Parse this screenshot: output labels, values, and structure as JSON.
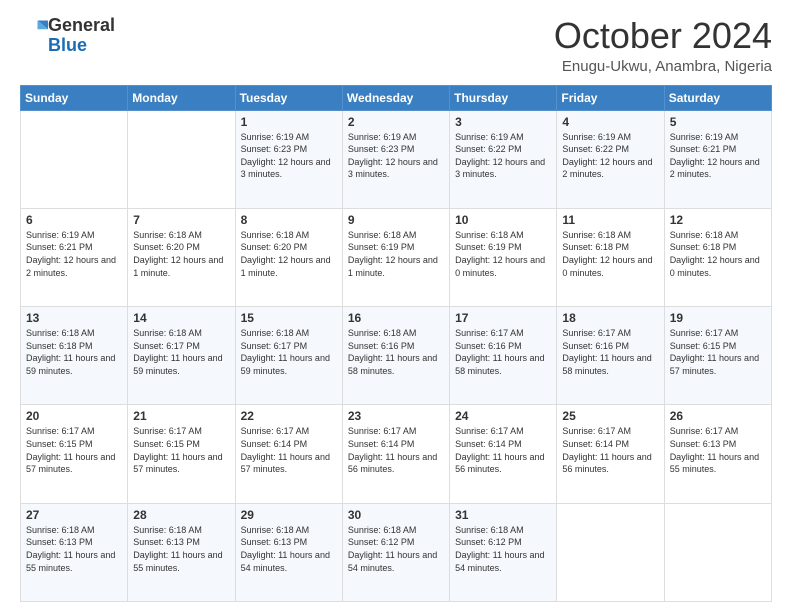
{
  "logo": {
    "general": "General",
    "blue": "Blue"
  },
  "header": {
    "month": "October 2024",
    "location": "Enugu-Ukwu, Anambra, Nigeria"
  },
  "weekdays": [
    "Sunday",
    "Monday",
    "Tuesday",
    "Wednesday",
    "Thursday",
    "Friday",
    "Saturday"
  ],
  "weeks": [
    [
      {
        "day": "",
        "info": ""
      },
      {
        "day": "",
        "info": ""
      },
      {
        "day": "1",
        "info": "Sunrise: 6:19 AM\nSunset: 6:23 PM\nDaylight: 12 hours and 3 minutes."
      },
      {
        "day": "2",
        "info": "Sunrise: 6:19 AM\nSunset: 6:23 PM\nDaylight: 12 hours and 3 minutes."
      },
      {
        "day": "3",
        "info": "Sunrise: 6:19 AM\nSunset: 6:22 PM\nDaylight: 12 hours and 3 minutes."
      },
      {
        "day": "4",
        "info": "Sunrise: 6:19 AM\nSunset: 6:22 PM\nDaylight: 12 hours and 2 minutes."
      },
      {
        "day": "5",
        "info": "Sunrise: 6:19 AM\nSunset: 6:21 PM\nDaylight: 12 hours and 2 minutes."
      }
    ],
    [
      {
        "day": "6",
        "info": "Sunrise: 6:19 AM\nSunset: 6:21 PM\nDaylight: 12 hours and 2 minutes."
      },
      {
        "day": "7",
        "info": "Sunrise: 6:18 AM\nSunset: 6:20 PM\nDaylight: 12 hours and 1 minute."
      },
      {
        "day": "8",
        "info": "Sunrise: 6:18 AM\nSunset: 6:20 PM\nDaylight: 12 hours and 1 minute."
      },
      {
        "day": "9",
        "info": "Sunrise: 6:18 AM\nSunset: 6:19 PM\nDaylight: 12 hours and 1 minute."
      },
      {
        "day": "10",
        "info": "Sunrise: 6:18 AM\nSunset: 6:19 PM\nDaylight: 12 hours and 0 minutes."
      },
      {
        "day": "11",
        "info": "Sunrise: 6:18 AM\nSunset: 6:18 PM\nDaylight: 12 hours and 0 minutes."
      },
      {
        "day": "12",
        "info": "Sunrise: 6:18 AM\nSunset: 6:18 PM\nDaylight: 12 hours and 0 minutes."
      }
    ],
    [
      {
        "day": "13",
        "info": "Sunrise: 6:18 AM\nSunset: 6:18 PM\nDaylight: 11 hours and 59 minutes."
      },
      {
        "day": "14",
        "info": "Sunrise: 6:18 AM\nSunset: 6:17 PM\nDaylight: 11 hours and 59 minutes."
      },
      {
        "day": "15",
        "info": "Sunrise: 6:18 AM\nSunset: 6:17 PM\nDaylight: 11 hours and 59 minutes."
      },
      {
        "day": "16",
        "info": "Sunrise: 6:18 AM\nSunset: 6:16 PM\nDaylight: 11 hours and 58 minutes."
      },
      {
        "day": "17",
        "info": "Sunrise: 6:17 AM\nSunset: 6:16 PM\nDaylight: 11 hours and 58 minutes."
      },
      {
        "day": "18",
        "info": "Sunrise: 6:17 AM\nSunset: 6:16 PM\nDaylight: 11 hours and 58 minutes."
      },
      {
        "day": "19",
        "info": "Sunrise: 6:17 AM\nSunset: 6:15 PM\nDaylight: 11 hours and 57 minutes."
      }
    ],
    [
      {
        "day": "20",
        "info": "Sunrise: 6:17 AM\nSunset: 6:15 PM\nDaylight: 11 hours and 57 minutes."
      },
      {
        "day": "21",
        "info": "Sunrise: 6:17 AM\nSunset: 6:15 PM\nDaylight: 11 hours and 57 minutes."
      },
      {
        "day": "22",
        "info": "Sunrise: 6:17 AM\nSunset: 6:14 PM\nDaylight: 11 hours and 57 minutes."
      },
      {
        "day": "23",
        "info": "Sunrise: 6:17 AM\nSunset: 6:14 PM\nDaylight: 11 hours and 56 minutes."
      },
      {
        "day": "24",
        "info": "Sunrise: 6:17 AM\nSunset: 6:14 PM\nDaylight: 11 hours and 56 minutes."
      },
      {
        "day": "25",
        "info": "Sunrise: 6:17 AM\nSunset: 6:14 PM\nDaylight: 11 hours and 56 minutes."
      },
      {
        "day": "26",
        "info": "Sunrise: 6:17 AM\nSunset: 6:13 PM\nDaylight: 11 hours and 55 minutes."
      }
    ],
    [
      {
        "day": "27",
        "info": "Sunrise: 6:18 AM\nSunset: 6:13 PM\nDaylight: 11 hours and 55 minutes."
      },
      {
        "day": "28",
        "info": "Sunrise: 6:18 AM\nSunset: 6:13 PM\nDaylight: 11 hours and 55 minutes."
      },
      {
        "day": "29",
        "info": "Sunrise: 6:18 AM\nSunset: 6:13 PM\nDaylight: 11 hours and 54 minutes."
      },
      {
        "day": "30",
        "info": "Sunrise: 6:18 AM\nSunset: 6:12 PM\nDaylight: 11 hours and 54 minutes."
      },
      {
        "day": "31",
        "info": "Sunrise: 6:18 AM\nSunset: 6:12 PM\nDaylight: 11 hours and 54 minutes."
      },
      {
        "day": "",
        "info": ""
      },
      {
        "day": "",
        "info": ""
      }
    ]
  ]
}
